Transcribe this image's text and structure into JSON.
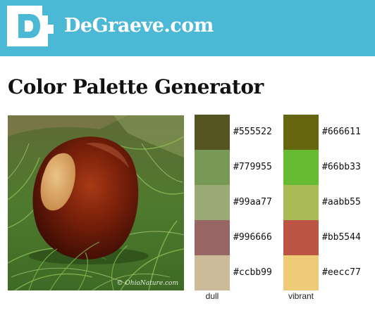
{
  "header": {
    "logo_letter": "D",
    "site_name": "DeGraeve.com",
    "background": "#4bb8d6"
  },
  "page": {
    "title": "Color Palette Generator"
  },
  "photo": {
    "subject": "horse chestnut on grass",
    "credit": "© OhioNature.com"
  },
  "palettes": {
    "dull": {
      "label": "dull",
      "swatches": [
        {
          "color": "#555522",
          "hex": "#555522"
        },
        {
          "color": "#779955",
          "hex": "#779955"
        },
        {
          "color": "#99aa77",
          "hex": "#99aa77"
        },
        {
          "color": "#996666",
          "hex": "#996666"
        },
        {
          "color": "#ccbb99",
          "hex": "#ccbb99"
        }
      ]
    },
    "vibrant": {
      "label": "vibrant",
      "swatches": [
        {
          "color": "#666611",
          "hex": "#666611"
        },
        {
          "color": "#66bb33",
          "hex": "#66bb33"
        },
        {
          "color": "#aabb55",
          "hex": "#aabb55"
        },
        {
          "color": "#bb5544",
          "hex": "#bb5544"
        },
        {
          "color": "#eecc77",
          "hex": "#eecc77"
        }
      ]
    }
  }
}
